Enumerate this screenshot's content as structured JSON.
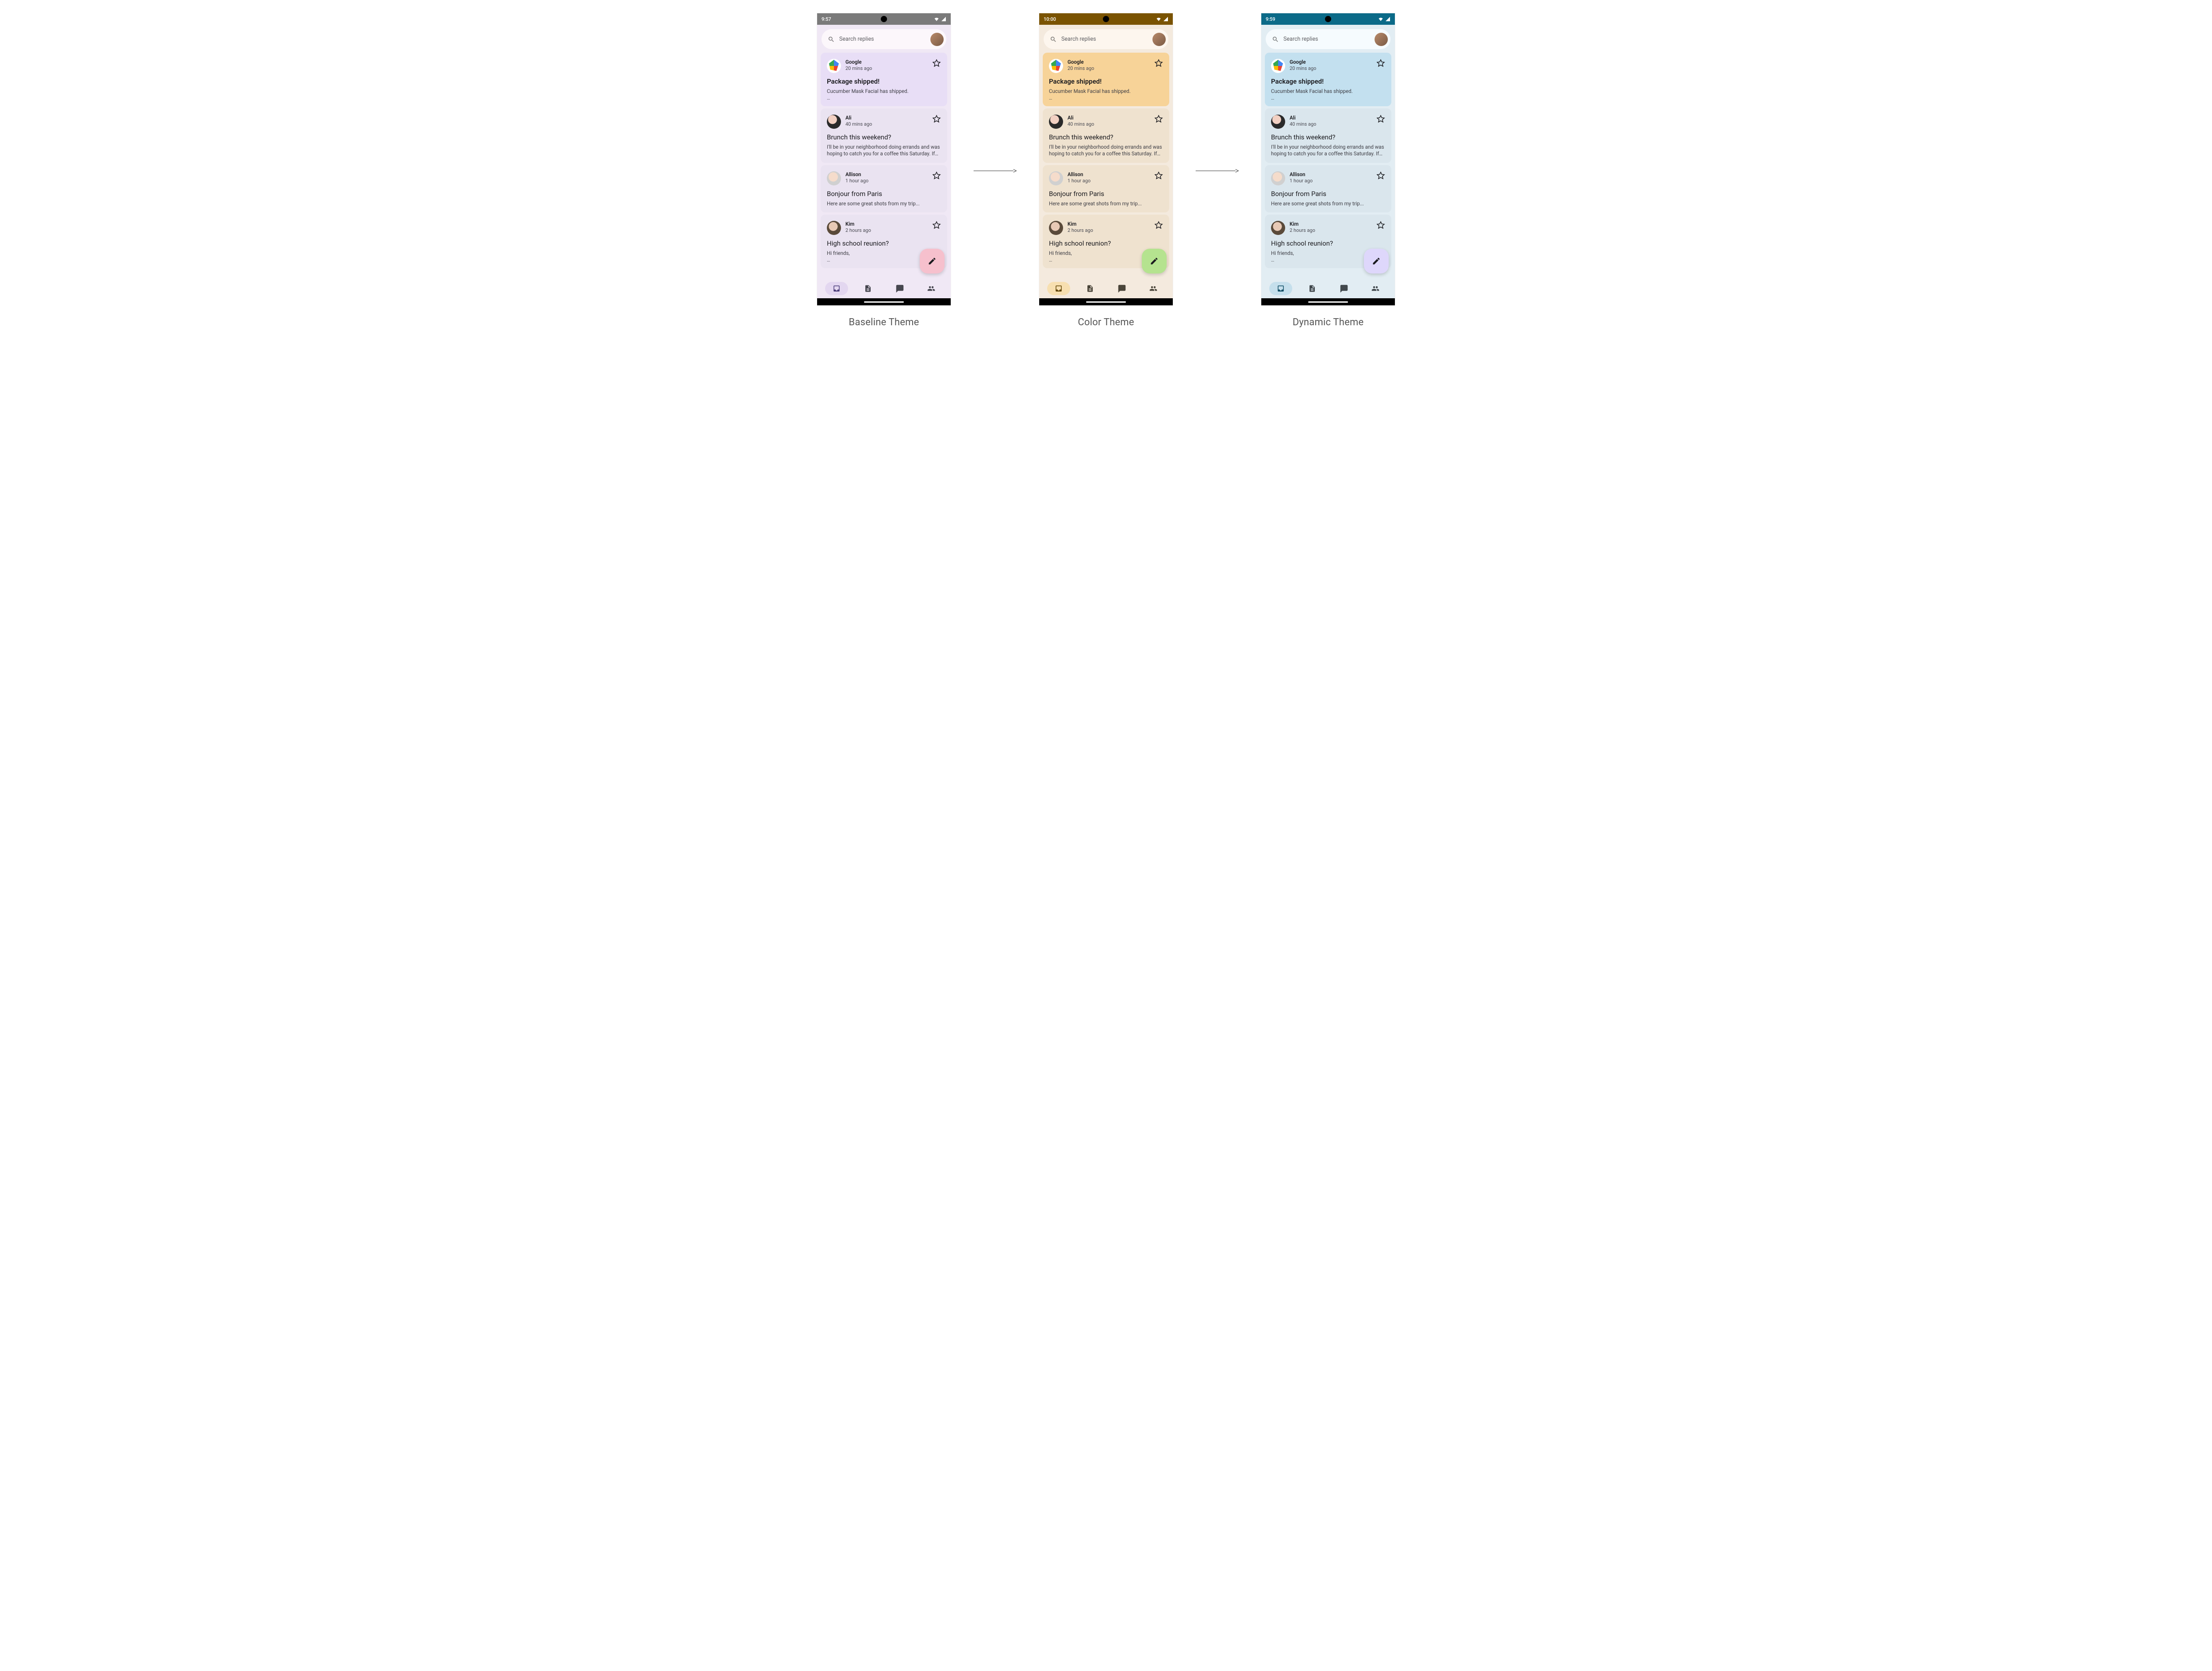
{
  "captions": [
    "Baseline Theme",
    "Color Theme",
    "Dynamic Theme"
  ],
  "search": {
    "placeholder": "Search replies"
  },
  "phones": [
    {
      "time": "9:57",
      "statusBg": "#7a7a7a",
      "statusLight": false,
      "bodyBg": "#f0e8f5",
      "searchBg": "#fcf7fb",
      "cardPrimaryBg": "#e8def6",
      "cardSecondaryBg": "#eae3f1",
      "navBg": "#f0e8f5",
      "navActiveBg": "#e3d7f0",
      "navActiveColor": "#4a3c78",
      "navInactiveColor": "#46464f",
      "fabBg": "#f6c0cd",
      "fabIcon": "#1b1b1f"
    },
    {
      "time": "10:00",
      "statusBg": "#7a5301",
      "statusLight": false,
      "bodyBg": "#f4eade",
      "searchBg": "#fdf6ee",
      "cardPrimaryBg": "#f7d398",
      "cardSecondaryBg": "#efe2cf",
      "navBg": "#f4eade",
      "navActiveBg": "#f7dfb0",
      "navActiveColor": "#5f4200",
      "navInactiveColor": "#4a4539",
      "fabBg": "#b5e38f",
      "fabIcon": "#1b1b1f"
    },
    {
      "time": "9:59",
      "statusBg": "#0b6a88",
      "statusLight": false,
      "bodyBg": "#e2edf3",
      "searchBg": "#f6fbfe",
      "cardPrimaryBg": "#c3e0ef",
      "cardSecondaryBg": "#dae6ed",
      "navBg": "#e2edf3",
      "navActiveBg": "#c5dfec",
      "navActiveColor": "#0b4a62",
      "navInactiveColor": "#41484d",
      "fabBg": "#ded7fb",
      "fabIcon": "#1b1b1f"
    }
  ],
  "emails": [
    {
      "avatar": "google",
      "sender": "Google",
      "time": "20 mins ago",
      "title": "Package shipped!",
      "titleBold": true,
      "snippet": "Cucumber Mask Facial has shipped.",
      "ellipsis": true
    },
    {
      "avatar": "person1",
      "sender": "Ali",
      "time": "40 mins ago",
      "title": "Brunch this weekend?",
      "titleBold": false,
      "snippet": "I'll be in your neighborhood doing errands and was hoping to catch you for a coffee this Saturday. If yo…",
      "ellipsis": false
    },
    {
      "avatar": "person2",
      "sender": "Allison",
      "time": "1 hour ago",
      "title": "Bonjour from Paris",
      "titleBold": false,
      "snippet": "Here are some great shots from my trip...",
      "ellipsis": false
    },
    {
      "avatar": "person3",
      "sender": "Kim",
      "time": "2 hours ago",
      "title": "High school reunion?",
      "titleBold": false,
      "snippet": "Hi friends,",
      "ellipsis": true
    }
  ],
  "nav": [
    "inbox",
    "articles",
    "chat",
    "people"
  ]
}
